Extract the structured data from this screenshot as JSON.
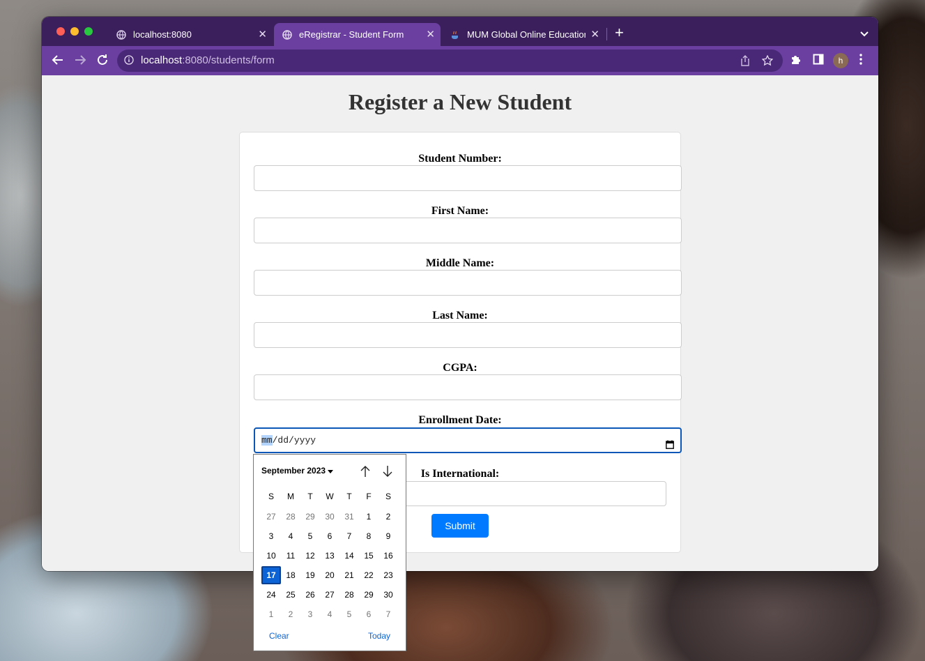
{
  "browser": {
    "tabs": [
      {
        "title": "localhost:8080",
        "active": false
      },
      {
        "title": "eRegistrar - Student Form",
        "active": true
      },
      {
        "title": "MUM Global Online Education",
        "active": false
      }
    ],
    "address": {
      "host": "localhost",
      "path": ":8080/students/form"
    },
    "profile_initial": "h",
    "accent_color": "#6a3fa0"
  },
  "page": {
    "title": "Register a New Student",
    "fields": {
      "student_number": {
        "label": "Student Number:",
        "value": ""
      },
      "first_name": {
        "label": "First Name:",
        "value": ""
      },
      "middle_name": {
        "label": "Middle Name:",
        "value": ""
      },
      "last_name": {
        "label": "Last Name:",
        "value": ""
      },
      "cgpa": {
        "label": "CGPA:",
        "value": ""
      },
      "enrollment_date": {
        "label": "Enrollment Date:",
        "mm": "mm",
        "sep": "/",
        "dd": "dd",
        "yyyy": "yyyy"
      },
      "is_international": {
        "label": "Is International:",
        "value": ""
      }
    },
    "submit_label": "Submit"
  },
  "datepicker": {
    "month_label": "September 2023",
    "weekdays": [
      "S",
      "M",
      "T",
      "W",
      "T",
      "F",
      "S"
    ],
    "weeks": [
      [
        "27",
        "28",
        "29",
        "30",
        "31",
        "1",
        "2"
      ],
      [
        "3",
        "4",
        "5",
        "6",
        "7",
        "8",
        "9"
      ],
      [
        "10",
        "11",
        "12",
        "13",
        "14",
        "15",
        "16"
      ],
      [
        "17",
        "18",
        "19",
        "20",
        "21",
        "22",
        "23"
      ],
      [
        "24",
        "25",
        "26",
        "27",
        "28",
        "29",
        "30"
      ],
      [
        "1",
        "2",
        "3",
        "4",
        "5",
        "6",
        "7"
      ]
    ],
    "selected_day": "17",
    "clear_label": "Clear",
    "today_label": "Today"
  }
}
